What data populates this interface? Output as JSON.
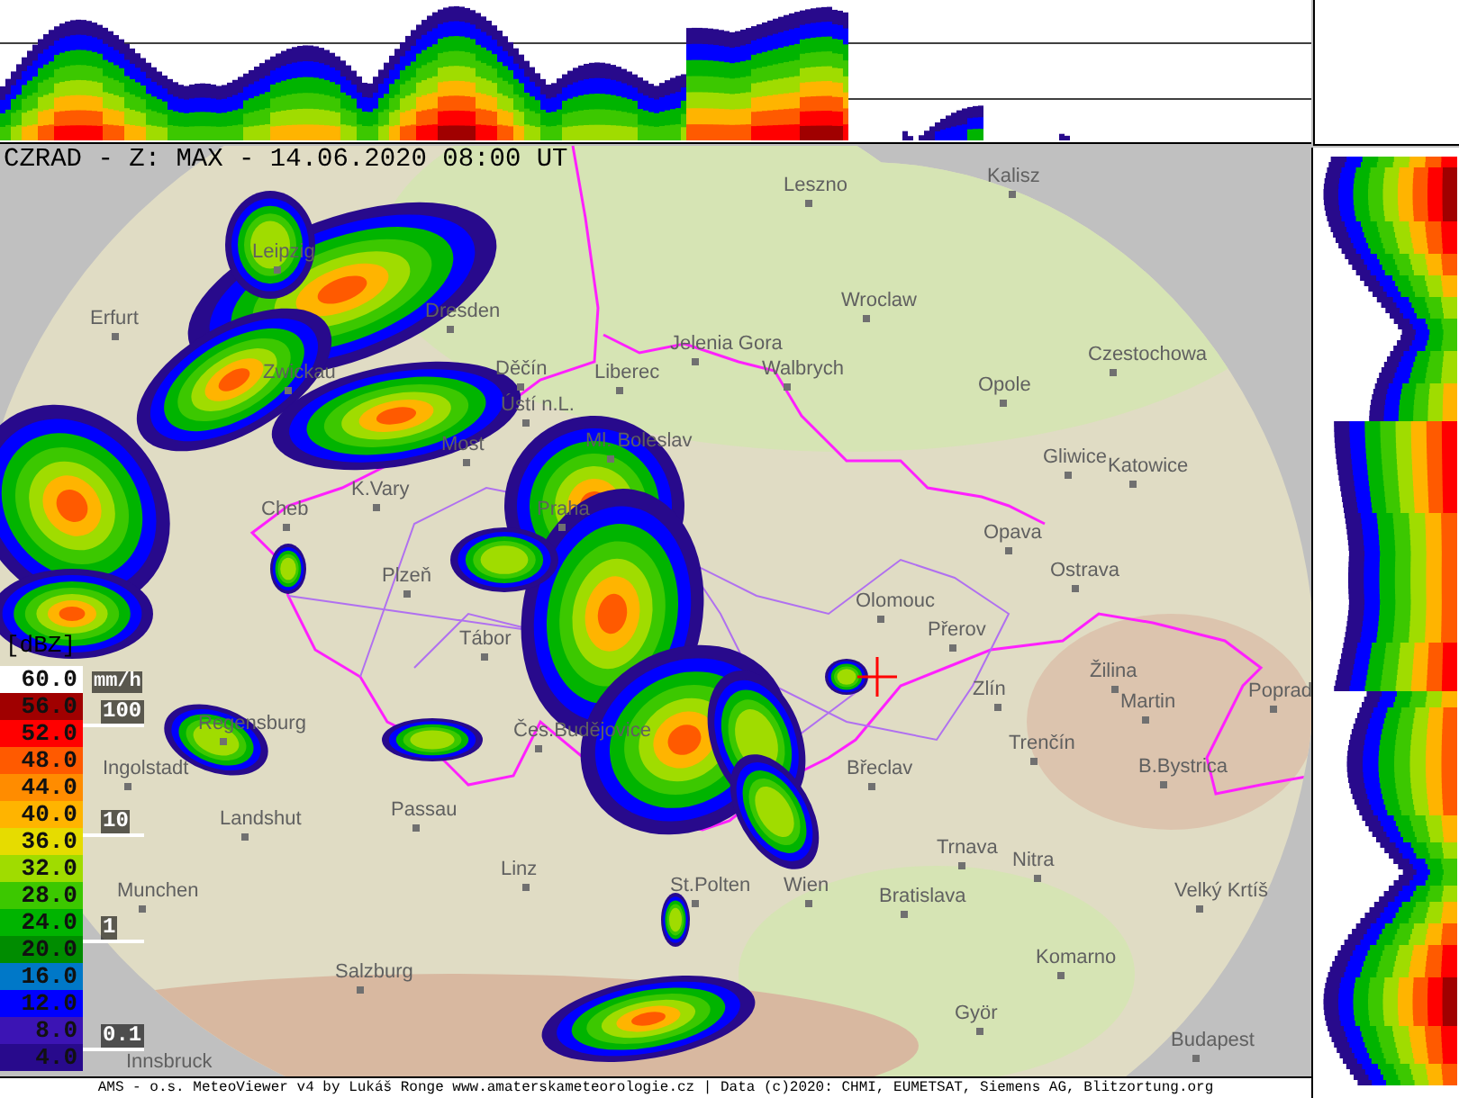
{
  "title": "CZRAD - Z: MAX - 14.06.2020 08:00 UT",
  "cities": [
    "Kalisz",
    "Leszno",
    "Leipzig",
    "Wroclaw",
    "Dresden",
    "Erfurt",
    "Jelenia Gora",
    "Czestochowa",
    "Zwickau",
    "Děčín",
    "Liberec",
    "Walbrych",
    "Opole",
    "Ústí n.L.",
    "Ml. Boleslav",
    "Most",
    "Gliwice",
    "Katowice",
    "K.Vary",
    "Cheb",
    "Praha",
    "Opava",
    "Ostrava",
    "Plzeň",
    "Olomouc",
    "Přerov",
    "Tábor",
    "Žilina",
    "Zlín",
    "Poprad",
    "Martin",
    "Regensburg",
    "Čes.Budějovice",
    "Trenčín",
    "Ingolstadt",
    "Břeclav",
    "B.Bystrica",
    "Passau",
    "Landshut",
    "Trnava",
    "Nitra",
    "Munchen",
    "Linz",
    "St.Polten",
    "Wien",
    "Bratislava",
    "Velký Krtíš",
    "Komarno",
    "Salzburg",
    "Györ",
    "Budapest",
    "Innsbruck"
  ],
  "legend": {
    "unit": "[dBZ]",
    "items": [
      {
        "value": "60.0",
        "color": "#ffffff"
      },
      {
        "value": "56.0",
        "color": "#a00000"
      },
      {
        "value": "52.0",
        "color": "#ff0000"
      },
      {
        "value": "48.0",
        "color": "#ff5a00"
      },
      {
        "value": "44.0",
        "color": "#ff8c00"
      },
      {
        "value": "40.0",
        "color": "#ffb400"
      },
      {
        "value": "36.0",
        "color": "#e6dc00"
      },
      {
        "value": "32.0",
        "color": "#a0dc00"
      },
      {
        "value": "28.0",
        "color": "#3cc800"
      },
      {
        "value": "24.0",
        "color": "#00b400"
      },
      {
        "value": "20.0",
        "color": "#008c00"
      },
      {
        "value": "16.0",
        "color": "#0078c8"
      },
      {
        "value": "12.0",
        "color": "#0000ff"
      },
      {
        "value": "8.0",
        "color": "#3c14b4"
      },
      {
        "value": "4.0",
        "color": "#280a8c"
      }
    ]
  },
  "rain_scale": {
    "unit": "mm/h",
    "marks": [
      "100",
      "10",
      "1",
      "0.1"
    ]
  },
  "footer": "AMS - o.s. MeteoViewer v4 by Lukáš Ronge www.amaterskameteorologie.cz | Data (c)2020: CHMI, EUMETSAT, Siemens AG, Blitzortung.org"
}
